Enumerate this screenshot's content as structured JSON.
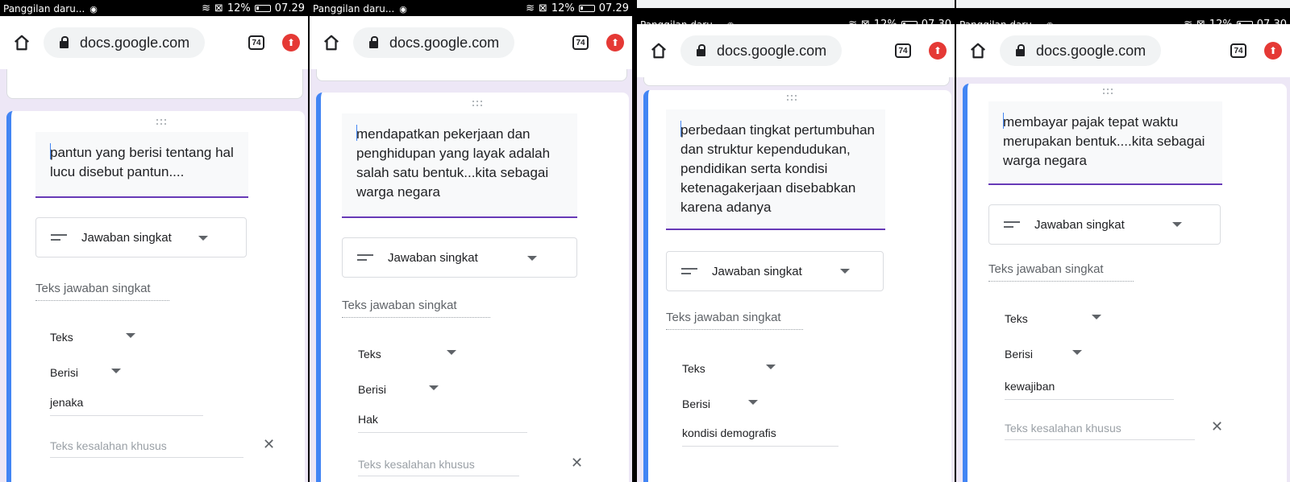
{
  "screens": [
    {
      "status": {
        "notification": "Panggilan daru...",
        "battery": "12%",
        "time": "07.29"
      },
      "browser": {
        "url": "docs.google.com",
        "tab_count": "74"
      },
      "question": "pantun yang berisi tentang hal lucu disebut pantun....",
      "answer_type": "Jawaban singkat",
      "short_answer_placeholder": "Teks jawaban singkat",
      "validation": {
        "type": "Teks",
        "condition": "Berisi",
        "value": "jenaka",
        "error_placeholder": "Teks kesalahan khusus"
      }
    },
    {
      "status": {
        "notification": "Panggilan daru...",
        "battery": "12%",
        "time": "07.29"
      },
      "browser": {
        "url": "docs.google.com",
        "tab_count": "74"
      },
      "question": "mendapatkan pekerjaan dan penghidupan yang layak adalah salah satu bentuk...kita sebagai warga negara",
      "answer_type": "Jawaban singkat",
      "short_answer_placeholder": "Teks jawaban singkat",
      "validation": {
        "type": "Teks",
        "condition": "Berisi",
        "value": "Hak",
        "error_placeholder": "Teks kesalahan khusus"
      }
    },
    {
      "status": {
        "notification": "Panggilan daru...",
        "battery": "12%",
        "time": "07.30"
      },
      "browser": {
        "url": "docs.google.com",
        "tab_count": "74"
      },
      "question": "perbedaan tingkat pertumbuhan dan struktur kependudukan, pendidikan serta kondisi ketenagakerjaan disebabkan karena adanya",
      "answer_type": "Jawaban singkat",
      "short_answer_placeholder": "Teks jawaban singkat",
      "validation": {
        "type": "Teks",
        "condition": "Berisi",
        "value": "kondisi demografis",
        "error_placeholder": ""
      }
    },
    {
      "status": {
        "notification": "Panggilan daru...",
        "battery": "12%",
        "time": "07.30"
      },
      "browser": {
        "url": "docs.google.com",
        "tab_count": "74"
      },
      "question": "membayar pajak tepat waktu merupakan bentuk....kita sebagai warga negara",
      "answer_type": "Jawaban singkat",
      "short_answer_placeholder": "Teks jawaban singkat",
      "validation": {
        "type": "Teks",
        "condition": "Berisi",
        "value": "kewajiban",
        "error_placeholder": "Teks kesalahan khusus"
      }
    }
  ]
}
